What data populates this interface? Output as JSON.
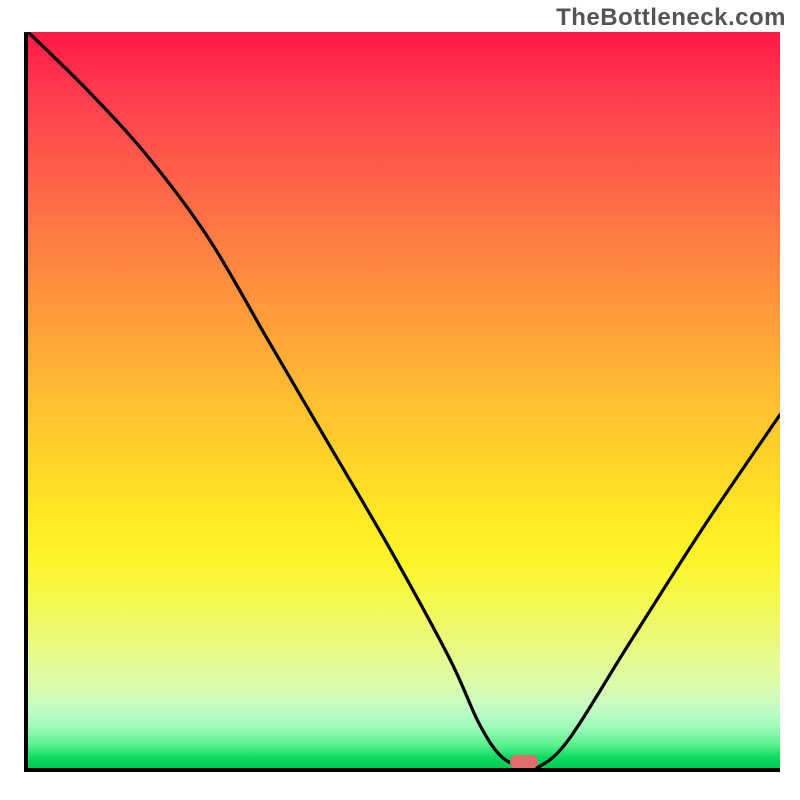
{
  "watermark": "TheBottleneck.com",
  "chart_data": {
    "type": "line",
    "title": "",
    "xlabel": "",
    "ylabel": "",
    "xlim": [
      0,
      100
    ],
    "ylim": [
      0,
      100
    ],
    "grid": false,
    "legend": false,
    "background": {
      "kind": "vertical-gradient",
      "stops": [
        {
          "pct": 0,
          "color": "#ff1847"
        },
        {
          "pct": 18,
          "color": "#fe5b4a"
        },
        {
          "pct": 38,
          "color": "#ff9a3a"
        },
        {
          "pct": 58,
          "color": "#ffd328"
        },
        {
          "pct": 72,
          "color": "#fcf52a"
        },
        {
          "pct": 89,
          "color": "#d9fbad"
        },
        {
          "pct": 97,
          "color": "#56f08a"
        },
        {
          "pct": 100,
          "color": "#00c94f"
        }
      ]
    },
    "series": [
      {
        "name": "bottleneck-curve",
        "points_note": "x is horizontal position 0-100 across plot, y is height 0-100 above bottom axis",
        "x": [
          0,
          8,
          16,
          24,
          32,
          40,
          48,
          56,
          60,
          63,
          66,
          68,
          72,
          80,
          90,
          100
        ],
        "y": [
          100,
          92,
          83,
          72,
          58,
          44,
          30,
          15,
          6,
          1.5,
          0.2,
          0.2,
          4,
          17,
          33,
          48
        ]
      }
    ],
    "marker": {
      "name": "optimal-point",
      "x": 66,
      "y": 0.8,
      "color": "#e26b6b",
      "shape": "pill"
    },
    "annotations": []
  }
}
